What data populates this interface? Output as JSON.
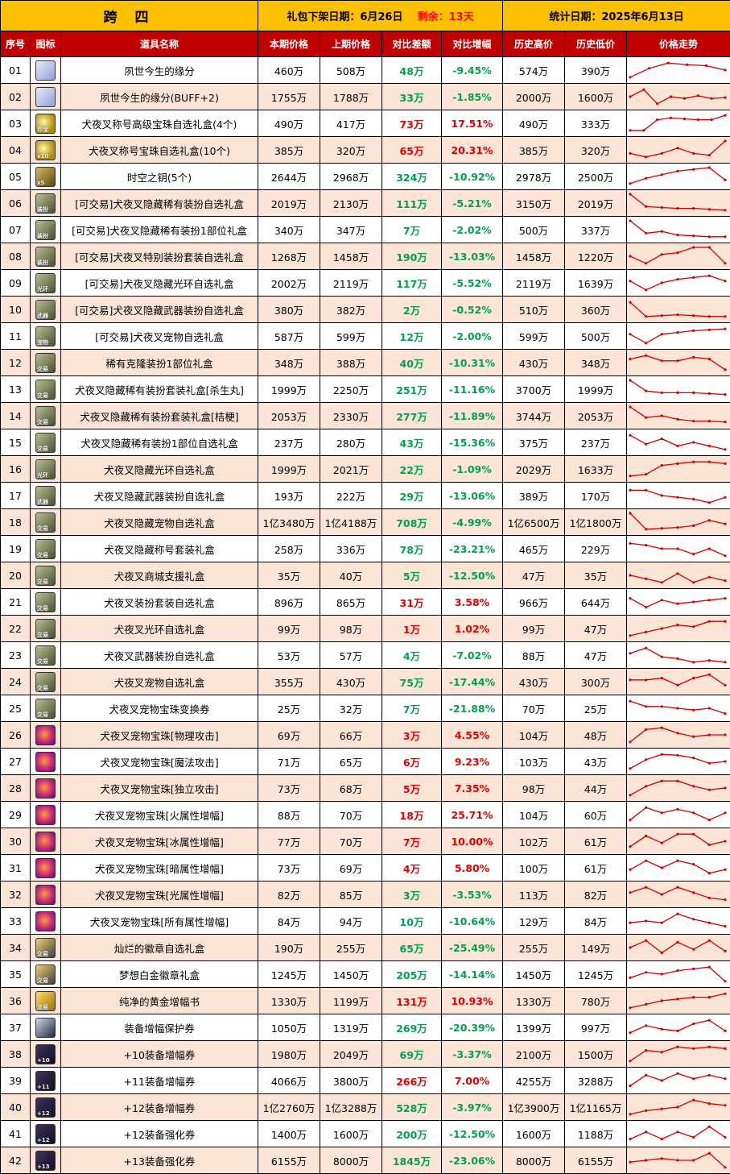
{
  "header": {
    "server": "跨 四",
    "release_label": "礼包下架日期：",
    "release_date": "6月26日",
    "remain_label": "剩余：",
    "remain_value": "13天",
    "stats_label": "统计日期：",
    "stats_date": "2025年6月13日"
  },
  "columns": [
    "序号",
    "图标",
    "道具名称",
    "本期价格",
    "上期价格",
    "对比差额",
    "对比增幅",
    "历史高价",
    "历史低价",
    "价格走势"
  ],
  "colors": {
    "header_yellow": "#ffc000",
    "header_red": "#c00000",
    "row_alt": "#fce4d6",
    "up": "#e00000",
    "down": "#00a050",
    "line": "#d00000"
  },
  "chart_data": {
    "type": "table",
    "rows": [
      {
        "no": "01",
        "icon": "ghost-icon",
        "icon_text": "",
        "name": "夙世今生的缘分",
        "cur": "460万",
        "prev": "508万",
        "diff": "48万",
        "pct": "-9.45%",
        "dir": "down",
        "high": "574万",
        "low": "390万",
        "trend": [
          0.1,
          0.6,
          0.9,
          0.8,
          0.75,
          0.5
        ]
      },
      {
        "no": "02",
        "icon": "ghost-icon",
        "icon_text": "",
        "name": "夙世今生的缘分(BUFF+2)",
        "cur": "1755万",
        "prev": "1788万",
        "diff": "33万",
        "pct": "-1.85%",
        "dir": "down",
        "high": "2000万",
        "low": "1600万",
        "trend": [
          0.5,
          0.9,
          0.1,
          0.5,
          0.4,
          0.55,
          0.4,
          0.45
        ]
      },
      {
        "no": "03",
        "icon": "orb-icon",
        "icon_text": "珍宝",
        "name": "犬夜叉称号高级宝珠自选礼盒(4个)",
        "cur": "490万",
        "prev": "417万",
        "diff": "73万",
        "pct": "17.51%",
        "dir": "up",
        "high": "490万",
        "low": "333万",
        "trend": [
          0.1,
          0.1,
          0.7,
          0.8,
          0.75,
          0.7,
          0.7,
          0.95
        ]
      },
      {
        "no": "04",
        "icon": "orb-icon",
        "icon_text": "x10",
        "name": "犬夜叉称号宝珠自选礼盒(10个)",
        "cur": "385万",
        "prev": "320万",
        "diff": "65万",
        "pct": "20.31%",
        "dir": "up",
        "high": "385万",
        "low": "320万",
        "trend": [
          0.3,
          0.1,
          0.3,
          0.6,
          0.3,
          0.2,
          1.0
        ]
      },
      {
        "no": "05",
        "icon": "key-icon",
        "icon_text": "x5",
        "name": "时空之钥(5个)",
        "cur": "2644万",
        "prev": "2968万",
        "diff": "324万",
        "pct": "-10.92%",
        "dir": "down",
        "high": "2978万",
        "low": "2500万",
        "trend": [
          0.1,
          0.4,
          0.6,
          0.8,
          0.9,
          1.0,
          0.3
        ]
      },
      {
        "no": "06",
        "icon": "chest-icon",
        "icon_text": "装扮",
        "name": "[可交易]犬夜叉隐藏稀有装扮自选礼盒",
        "cur": "2019万",
        "prev": "2130万",
        "diff": "111万",
        "pct": "-5.21%",
        "dir": "down",
        "high": "3150万",
        "low": "2019万",
        "trend": [
          1.0,
          0.3,
          0.25,
          0.2,
          0.2,
          0.15,
          0.1
        ]
      },
      {
        "no": "07",
        "icon": "chest-icon",
        "icon_text": "装扮",
        "name": "[可交易]犬夜叉隐藏稀有装扮1部位礼盒",
        "cur": "340万",
        "prev": "347万",
        "diff": "7万",
        "pct": "-2.02%",
        "dir": "down",
        "high": "500万",
        "low": "337万",
        "trend": [
          1.0,
          0.3,
          0.4,
          0.2,
          0.15,
          0.1,
          0.1
        ]
      },
      {
        "no": "08",
        "icon": "chest-icon",
        "icon_text": "装扮",
        "name": "[可交易]犬夜叉特别装扮套装自选礼盒",
        "cur": "1268万",
        "prev": "1458万",
        "diff": "190万",
        "pct": "-13.03%",
        "dir": "down",
        "high": "1458万",
        "low": "1220万",
        "trend": [
          0.5,
          0.1,
          0.6,
          0.7,
          1.0,
          1.0,
          0.1
        ]
      },
      {
        "no": "09",
        "icon": "chest-icon",
        "icon_text": "光环",
        "name": "[可交易]犬夜叉隐藏光环自选礼盒",
        "cur": "2002万",
        "prev": "2119万",
        "diff": "117万",
        "pct": "-5.52%",
        "dir": "down",
        "high": "2119万",
        "low": "1639万",
        "trend": [
          0.6,
          0.1,
          0.5,
          0.7,
          0.8,
          0.9,
          0.6
        ]
      },
      {
        "no": "10",
        "icon": "chest-icon",
        "icon_text": "武器",
        "name": "[可交易]犬夜叉隐藏武器装扮自选礼盒",
        "cur": "380万",
        "prev": "382万",
        "diff": "2万",
        "pct": "-0.52%",
        "dir": "down",
        "high": "510万",
        "low": "360万",
        "trend": [
          0.9,
          0.1,
          0.15,
          0.2,
          0.15,
          0.1,
          0.1
        ]
      },
      {
        "no": "11",
        "icon": "chest-icon",
        "icon_text": "宠物",
        "name": "[可交易]犬夜叉宠物自选礼盒",
        "cur": "587万",
        "prev": "599万",
        "diff": "12万",
        "pct": "-2.00%",
        "dir": "down",
        "high": "599万",
        "low": "500万",
        "trend": [
          0.6,
          0.1,
          0.6,
          0.7,
          0.8,
          0.85,
          0.9
        ]
      },
      {
        "no": "12",
        "icon": "chest-icon",
        "icon_text": "交易",
        "name": "稀有克隆装扮1部位礼盒",
        "cur": "348万",
        "prev": "388万",
        "diff": "40万",
        "pct": "-10.31%",
        "dir": "down",
        "high": "430万",
        "low": "348万",
        "trend": [
          0.7,
          0.9,
          0.6,
          0.6,
          0.8,
          0.7,
          0.1
        ]
      },
      {
        "no": "13",
        "icon": "chest-icon",
        "icon_text": "交易",
        "name": "犬夜叉隐藏稀有装扮套装礼盒[杀生丸]",
        "cur": "1999万",
        "prev": "2250万",
        "diff": "251万",
        "pct": "-11.16%",
        "dir": "down",
        "high": "3700万",
        "low": "1999万",
        "trend": [
          1.0,
          0.4,
          0.3,
          0.3,
          0.3,
          0.25,
          0.2
        ]
      },
      {
        "no": "14",
        "icon": "chest-icon",
        "icon_text": "交易",
        "name": "犬夜叉隐藏稀有装扮套装礼盒[桔梗]",
        "cur": "2053万",
        "prev": "2330万",
        "diff": "277万",
        "pct": "-11.89%",
        "dir": "down",
        "high": "3744万",
        "low": "2053万",
        "trend": [
          1.0,
          0.4,
          0.5,
          0.3,
          0.2,
          0.2,
          0.15
        ]
      },
      {
        "no": "15",
        "icon": "chest-icon",
        "icon_text": "交易",
        "name": "犬夜叉隐藏稀有装扮1部位自选礼盒",
        "cur": "237万",
        "prev": "280万",
        "diff": "43万",
        "pct": "-15.36%",
        "dir": "down",
        "high": "375万",
        "low": "237万",
        "trend": [
          0.9,
          0.4,
          0.7,
          0.3,
          0.5,
          0.3,
          0.1
        ]
      },
      {
        "no": "16",
        "icon": "chest-icon",
        "icon_text": "光环",
        "name": "犬夜叉隐藏光环自选礼盒",
        "cur": "1999万",
        "prev": "2021万",
        "diff": "22万",
        "pct": "-1.09%",
        "dir": "down",
        "high": "2029万",
        "low": "1633万",
        "trend": [
          0.1,
          0.2,
          0.7,
          0.8,
          0.9,
          0.9,
          0.8
        ]
      },
      {
        "no": "17",
        "icon": "chest-icon",
        "icon_text": "武器",
        "name": "犬夜叉隐藏武器装扮自选礼盒",
        "cur": "193万",
        "prev": "222万",
        "diff": "29万",
        "pct": "-13.06%",
        "dir": "down",
        "high": "389万",
        "low": "170万",
        "trend": [
          0.8,
          0.8,
          0.5,
          0.4,
          0.3,
          0.1,
          0.4
        ]
      },
      {
        "no": "18",
        "icon": "chest-icon",
        "icon_text": "交易",
        "name": "犬夜叉隐藏宠物自选礼盒",
        "cur": "1亿3480万",
        "prev": "1亿4188万",
        "diff": "708万",
        "pct": "-4.99%",
        "dir": "down",
        "high": "1亿6500万",
        "low": "1亿1800万",
        "trend": [
          1.0,
          0.1,
          0.15,
          0.2,
          0.3,
          0.6,
          0.4
        ]
      },
      {
        "no": "19",
        "icon": "chest-icon",
        "icon_text": "交易",
        "name": "犬夜叉隐藏称号套装礼盒",
        "cur": "258万",
        "prev": "336万",
        "diff": "78万",
        "pct": "-23.21%",
        "dir": "down",
        "high": "465万",
        "low": "229万",
        "trend": [
          0.8,
          0.7,
          0.5,
          0.5,
          0.2,
          0.5,
          0.1
        ]
      },
      {
        "no": "20",
        "icon": "chest-icon",
        "icon_text": "交易",
        "name": "犬夜叉商城支援礼盒",
        "cur": "35万",
        "prev": "40万",
        "diff": "5万",
        "pct": "-12.50%",
        "dir": "down",
        "high": "47万",
        "low": "35万",
        "trend": [
          0.5,
          0.3,
          0.1,
          0.6,
          0.1,
          0.4,
          0.2
        ]
      },
      {
        "no": "21",
        "icon": "chest-icon",
        "icon_text": "交易",
        "name": "犬夜叉装扮套装自选礼盒",
        "cur": "896万",
        "prev": "865万",
        "diff": "31万",
        "pct": "3.58%",
        "dir": "up",
        "high": "966万",
        "low": "644万",
        "trend": [
          0.7,
          0.2,
          0.6,
          0.4,
          0.5,
          0.6,
          0.7
        ]
      },
      {
        "no": "22",
        "icon": "chest-icon",
        "icon_text": "交易",
        "name": "犬夜叉光环自选礼盒",
        "cur": "99万",
        "prev": "98万",
        "diff": "1万",
        "pct": "1.02%",
        "dir": "up",
        "high": "99万",
        "low": "47万",
        "trend": [
          0.1,
          0.3,
          0.5,
          0.7,
          0.6,
          0.9,
          0.9
        ]
      },
      {
        "no": "23",
        "icon": "chest-icon",
        "icon_text": "交易",
        "name": "犬夜叉武器装扮自选礼盒",
        "cur": "53万",
        "prev": "57万",
        "diff": "4万",
        "pct": "-7.02%",
        "dir": "down",
        "high": "88万",
        "low": "47万",
        "trend": [
          0.6,
          0.9,
          0.4,
          0.3,
          0.1,
          0.2,
          0.1
        ]
      },
      {
        "no": "24",
        "icon": "chest-icon",
        "icon_text": "交易",
        "name": "犬夜叉宠物自选礼盒",
        "cur": "355万",
        "prev": "430万",
        "diff": "75万",
        "pct": "-17.44%",
        "dir": "down",
        "high": "430万",
        "low": "300万",
        "trend": [
          0.6,
          0.6,
          0.7,
          0.3,
          0.7,
          0.9,
          0.3
        ]
      },
      {
        "no": "25",
        "icon": "chest-icon",
        "icon_text": "交易",
        "name": "犬夜叉宠物宝珠变换券",
        "cur": "25万",
        "prev": "32万",
        "diff": "7万",
        "pct": "-21.88%",
        "dir": "down",
        "high": "70万",
        "low": "25万",
        "trend": [
          0.9,
          0.6,
          0.6,
          0.5,
          0.4,
          0.5,
          0.2
        ]
      },
      {
        "no": "26",
        "icon": "gem-icon",
        "icon_text": "",
        "name": "犬夜叉宠物宝珠[物理攻击]",
        "cur": "69万",
        "prev": "66万",
        "diff": "3万",
        "pct": "4.55%",
        "dir": "up",
        "high": "104万",
        "low": "48万",
        "trend": [
          0.1,
          0.8,
          0.9,
          0.6,
          0.4,
          0.5,
          0.5
        ]
      },
      {
        "no": "27",
        "icon": "gem-icon",
        "icon_text": "",
        "name": "犬夜叉宠物宝珠[魔法攻击]",
        "cur": "71万",
        "prev": "65万",
        "diff": "6万",
        "pct": "9.23%",
        "dir": "up",
        "high": "103万",
        "low": "43万",
        "trend": [
          0.1,
          0.6,
          0.9,
          0.85,
          0.7,
          0.4,
          0.5
        ]
      },
      {
        "no": "28",
        "icon": "gem-icon",
        "icon_text": "",
        "name": "犬夜叉宠物宝珠[独立攻击]",
        "cur": "73万",
        "prev": "68万",
        "diff": "5万",
        "pct": "7.35%",
        "dir": "up",
        "high": "98万",
        "low": "44万",
        "trend": [
          0.1,
          0.6,
          0.9,
          0.9,
          0.6,
          0.4,
          0.5
        ]
      },
      {
        "no": "29",
        "icon": "gem-icon",
        "icon_text": "",
        "name": "犬夜叉宠物宝珠[火属性增幅]",
        "cur": "88万",
        "prev": "70万",
        "diff": "18万",
        "pct": "25.71%",
        "dir": "up",
        "high": "104万",
        "low": "60万",
        "trend": [
          0.2,
          0.9,
          0.6,
          0.8,
          0.6,
          0.2,
          0.6
        ]
      },
      {
        "no": "30",
        "icon": "gem-icon",
        "icon_text": "",
        "name": "犬夜叉宠物宝珠[冰属性增幅]",
        "cur": "77万",
        "prev": "70万",
        "diff": "7万",
        "pct": "10.00%",
        "dir": "up",
        "high": "102万",
        "low": "61万",
        "trend": [
          0.2,
          0.8,
          0.4,
          0.9,
          0.9,
          0.3,
          0.5
        ]
      },
      {
        "no": "31",
        "icon": "gem-icon",
        "icon_text": "",
        "name": "犬夜叉宠物宝珠[暗属性增幅]",
        "cur": "73万",
        "prev": "69万",
        "diff": "4万",
        "pct": "5.80%",
        "dir": "up",
        "high": "100万",
        "low": "61万",
        "trend": [
          0.4,
          0.9,
          0.5,
          0.9,
          0.7,
          0.2,
          0.4
        ]
      },
      {
        "no": "32",
        "icon": "gem-icon",
        "icon_text": "",
        "name": "犬夜叉宠物宝珠[光属性增幅]",
        "cur": "82万",
        "prev": "85万",
        "diff": "3万",
        "pct": "-3.53%",
        "dir": "down",
        "high": "113万",
        "low": "82万",
        "trend": [
          0.6,
          0.9,
          0.5,
          0.9,
          0.6,
          0.3,
          0.2
        ]
      },
      {
        "no": "33",
        "icon": "gem-icon",
        "icon_text": "",
        "name": "犬夜叉宠物宝珠[所有属性增幅]",
        "cur": "84万",
        "prev": "94万",
        "diff": "10万",
        "pct": "-10.64%",
        "dir": "down",
        "high": "129万",
        "low": "84万",
        "trend": [
          0.4,
          0.5,
          0.4,
          0.9,
          0.6,
          0.4,
          0.2
        ]
      },
      {
        "no": "34",
        "icon": "badge-icon",
        "icon_text": "交易",
        "name": "灿烂的徽章自选礼盒",
        "cur": "190万",
        "prev": "255万",
        "diff": "65万",
        "pct": "-25.49%",
        "dir": "down",
        "high": "255万",
        "low": "149万",
        "trend": [
          0.5,
          0.9,
          0.2,
          0.8,
          0.4,
          0.9,
          0.3
        ]
      },
      {
        "no": "35",
        "icon": "badge-icon",
        "icon_text": "交易",
        "name": "梦想白金徽章礼盒",
        "cur": "1245万",
        "prev": "1450万",
        "diff": "205万",
        "pct": "-14.14%",
        "dir": "down",
        "high": "1450万",
        "low": "1245万",
        "trend": [
          0.3,
          0.6,
          0.5,
          0.7,
          0.8,
          0.9,
          0.1
        ]
      },
      {
        "no": "36",
        "icon": "book-icon",
        "icon_text": "交易",
        "name": "纯净的黄金增幅书",
        "cur": "1330万",
        "prev": "1199万",
        "diff": "131万",
        "pct": "10.93%",
        "dir": "up",
        "high": "1330万",
        "low": "780万",
        "trend": [
          0.1,
          0.3,
          0.5,
          0.6,
          0.7,
          0.7,
          0.9
        ]
      },
      {
        "no": "37",
        "icon": "scroll-icon",
        "icon_text": "",
        "name": "装备增幅保护券",
        "cur": "1050万",
        "prev": "1319万",
        "diff": "269万",
        "pct": "-20.39%",
        "dir": "down",
        "high": "1399万",
        "low": "997万",
        "trend": [
          0.2,
          0.6,
          0.4,
          0.3,
          0.7,
          0.9,
          0.3
        ]
      },
      {
        "no": "38",
        "icon": "ticket-icon",
        "icon_text": "+10",
        "name": "+10装备增幅券",
        "cur": "1980万",
        "prev": "2049万",
        "diff": "69万",
        "pct": "-3.37%",
        "dir": "down",
        "high": "2100万",
        "low": "1500万",
        "trend": [
          0.1,
          0.7,
          0.6,
          0.9,
          0.8,
          0.9,
          0.8
        ]
      },
      {
        "no": "39",
        "icon": "ticket-icon",
        "icon_text": "+11",
        "name": "+11装备增幅券",
        "cur": "4066万",
        "prev": "3800万",
        "diff": "266万",
        "pct": "7.00%",
        "dir": "up",
        "high": "4255万",
        "low": "3288万",
        "trend": [
          0.2,
          0.8,
          0.5,
          0.9,
          0.6,
          0.8,
          0.6
        ]
      },
      {
        "no": "40",
        "icon": "ticket-icon",
        "icon_text": "+12",
        "name": "+12装备增幅券",
        "cur": "1亿2760万",
        "prev": "1亿3288万",
        "diff": "528万",
        "pct": "-3.97%",
        "dir": "down",
        "high": "1亿3900万",
        "low": "1亿1165万",
        "trend": [
          0.1,
          0.3,
          0.4,
          0.5,
          0.9,
          0.7,
          0.6
        ]
      },
      {
        "no": "41",
        "icon": "ticket-icon",
        "icon_text": "+12",
        "name": "+12装备强化券",
        "cur": "1400万",
        "prev": "1600万",
        "diff": "200万",
        "pct": "-12.50%",
        "dir": "down",
        "high": "1600万",
        "low": "1188万",
        "trend": [
          0.2,
          0.6,
          0.2,
          0.6,
          0.3,
          0.9,
          0.3
        ]
      },
      {
        "no": "42",
        "icon": "ticket-icon",
        "icon_text": "+13",
        "name": "+13装备强化券",
        "cur": "6155万",
        "prev": "8000万",
        "diff": "1845万",
        "pct": "-23.06%",
        "dir": "down",
        "high": "8000万",
        "low": "6155万",
        "trend": [
          0.4,
          0.5,
          0.6,
          0.5,
          0.5,
          0.9,
          0.1
        ]
      }
    ]
  }
}
